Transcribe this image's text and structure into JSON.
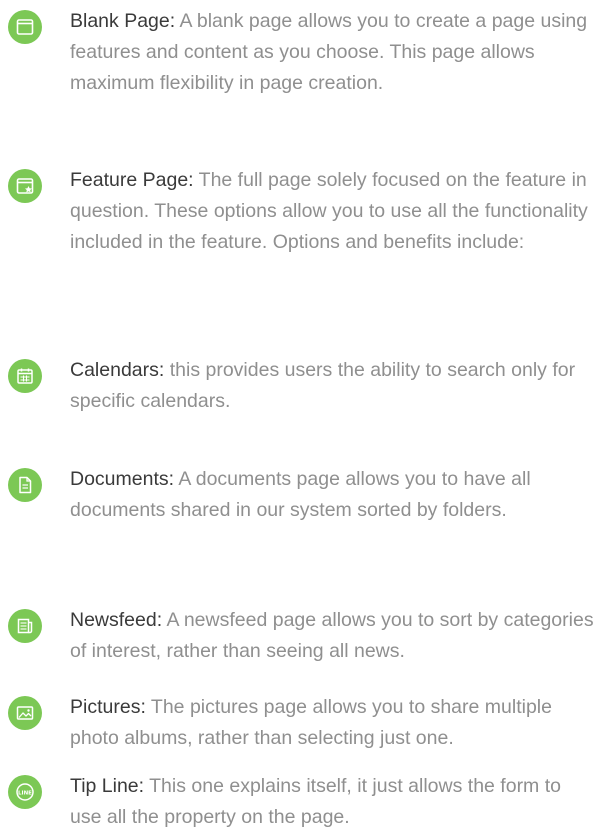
{
  "items": [
    {
      "term": "Blank Page:",
      "description": " A blank page allows you to create a page using features and content as you choose. This page allows maximum flexibility in page creation.",
      "icon": "blank-page-icon"
    },
    {
      "term": "Feature Page:",
      "description": " The full page solely focused on the feature in question. These options allow you to use all the functionality included in the feature. Options and benefits include:",
      "icon": "feature-page-icon"
    },
    {
      "term": "Calendars:",
      "description": "  this provides users the ability to search only for specific calendars.",
      "icon": "calendar-icon"
    },
    {
      "term": "Documents:",
      "description": " A documents page allows you to have all documents shared in our system sorted by folders.",
      "icon": "document-icon"
    },
    {
      "term": "Newsfeed:",
      "description": " A newsfeed page allows you to sort by categories of interest, rather than seeing all news.",
      "icon": "newsfeed-icon"
    },
    {
      "term": "Pictures:",
      "description": " The pictures page allows you to share multiple photo albums, rather than selecting just one.",
      "icon": "pictures-icon"
    },
    {
      "term": "Tip Line:",
      "description": " This one explains itself, it just allows the form to use all the property on the page.",
      "icon": "tip-line-icon"
    }
  ],
  "colors": {
    "icon_background": "#7cc855",
    "term_text": "#3a3a3a",
    "description_text": "#8f8f8f"
  }
}
